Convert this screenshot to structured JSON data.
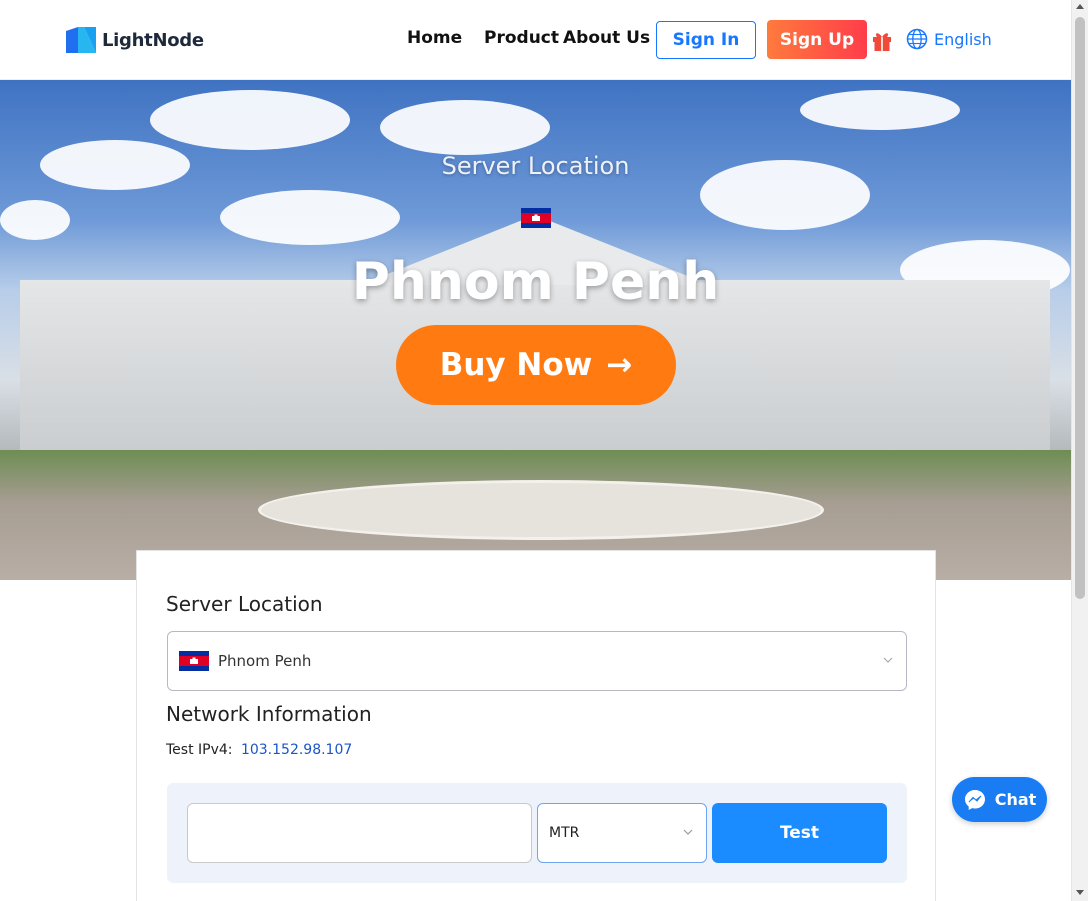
{
  "header": {
    "logo_text": "LightNode",
    "nav": {
      "home": "Home",
      "product": "Product",
      "about": "About Us"
    },
    "sign_in": "Sign In",
    "sign_up": "Sign Up",
    "language": "English"
  },
  "hero": {
    "subtitle": "Server Location",
    "city": "Phnom Penh",
    "buy_label": "Buy Now",
    "buy_arrow": "→"
  },
  "location": {
    "title": "Server Location",
    "selected": "Phnom Penh"
  },
  "network": {
    "title": "Network Information",
    "ipv4_label": "Test IPv4:",
    "ipv4_value": "103.152.98.107",
    "input_value": "",
    "method_selected": "MTR",
    "test_button": "Test"
  },
  "chat": {
    "label": "Chat"
  },
  "colors": {
    "primary": "#1677ff",
    "accent_orange": "#ff7a10",
    "signup_gradient_start": "#ff7a3d",
    "signup_gradient_end": "#ff3d4a"
  }
}
